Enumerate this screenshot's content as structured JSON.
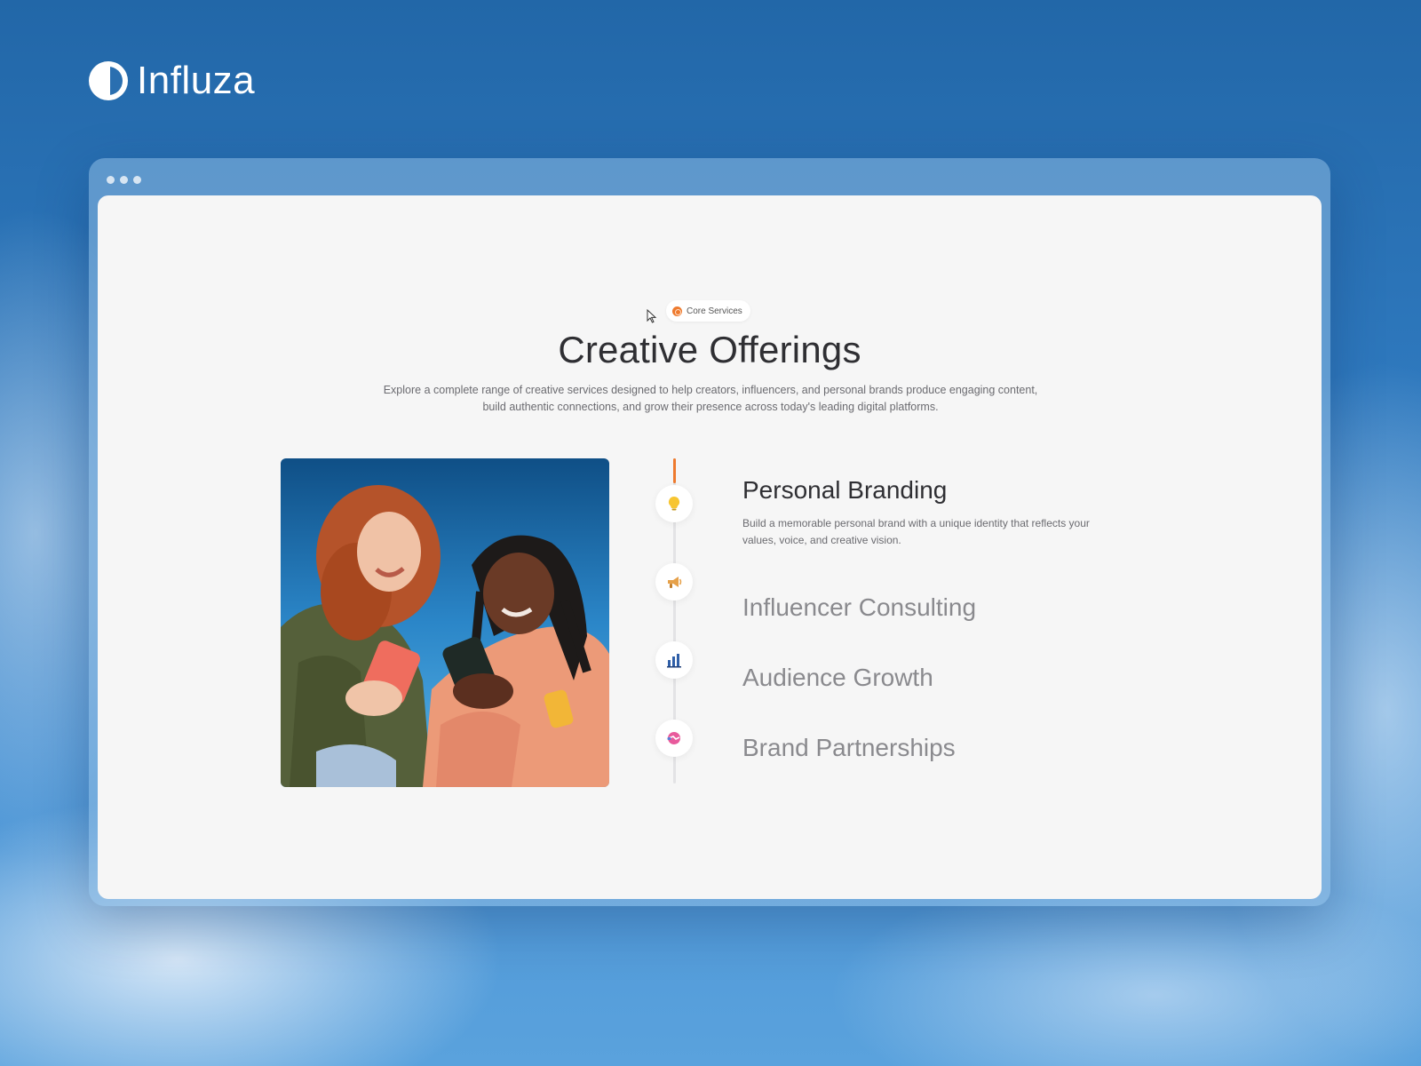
{
  "brand": {
    "name": "Influza",
    "icon": "half-circle-logo-icon"
  },
  "window": {
    "dots": 3
  },
  "section": {
    "badge_label": "Core Services",
    "badge_icon": "globe-icon",
    "title": "Creative Offerings",
    "subtitle": "Explore a complete range of creative services designed to help creators, influencers, and personal brands produce engaging content, build authentic connections, and grow their presence across today's leading digital platforms."
  },
  "image": {
    "alt": "photo-two-women-with-phones"
  },
  "services": [
    {
      "title": "Personal Branding",
      "description": "Build a memorable personal brand with a unique identity that reflects your values, voice, and creative vision.",
      "icon": "lightbulb-icon",
      "active": true
    },
    {
      "title": "Influencer Consulting",
      "icon": "megaphone-icon",
      "active": false
    },
    {
      "title": "Audience Growth",
      "icon": "bar-chart-icon",
      "active": false
    },
    {
      "title": "Brand Partnerships",
      "icon": "handshake-icon",
      "active": false
    }
  ],
  "colors": {
    "accent": "#ee7a2e",
    "title": "#2f2f33",
    "muted": "#8a8a8e"
  }
}
